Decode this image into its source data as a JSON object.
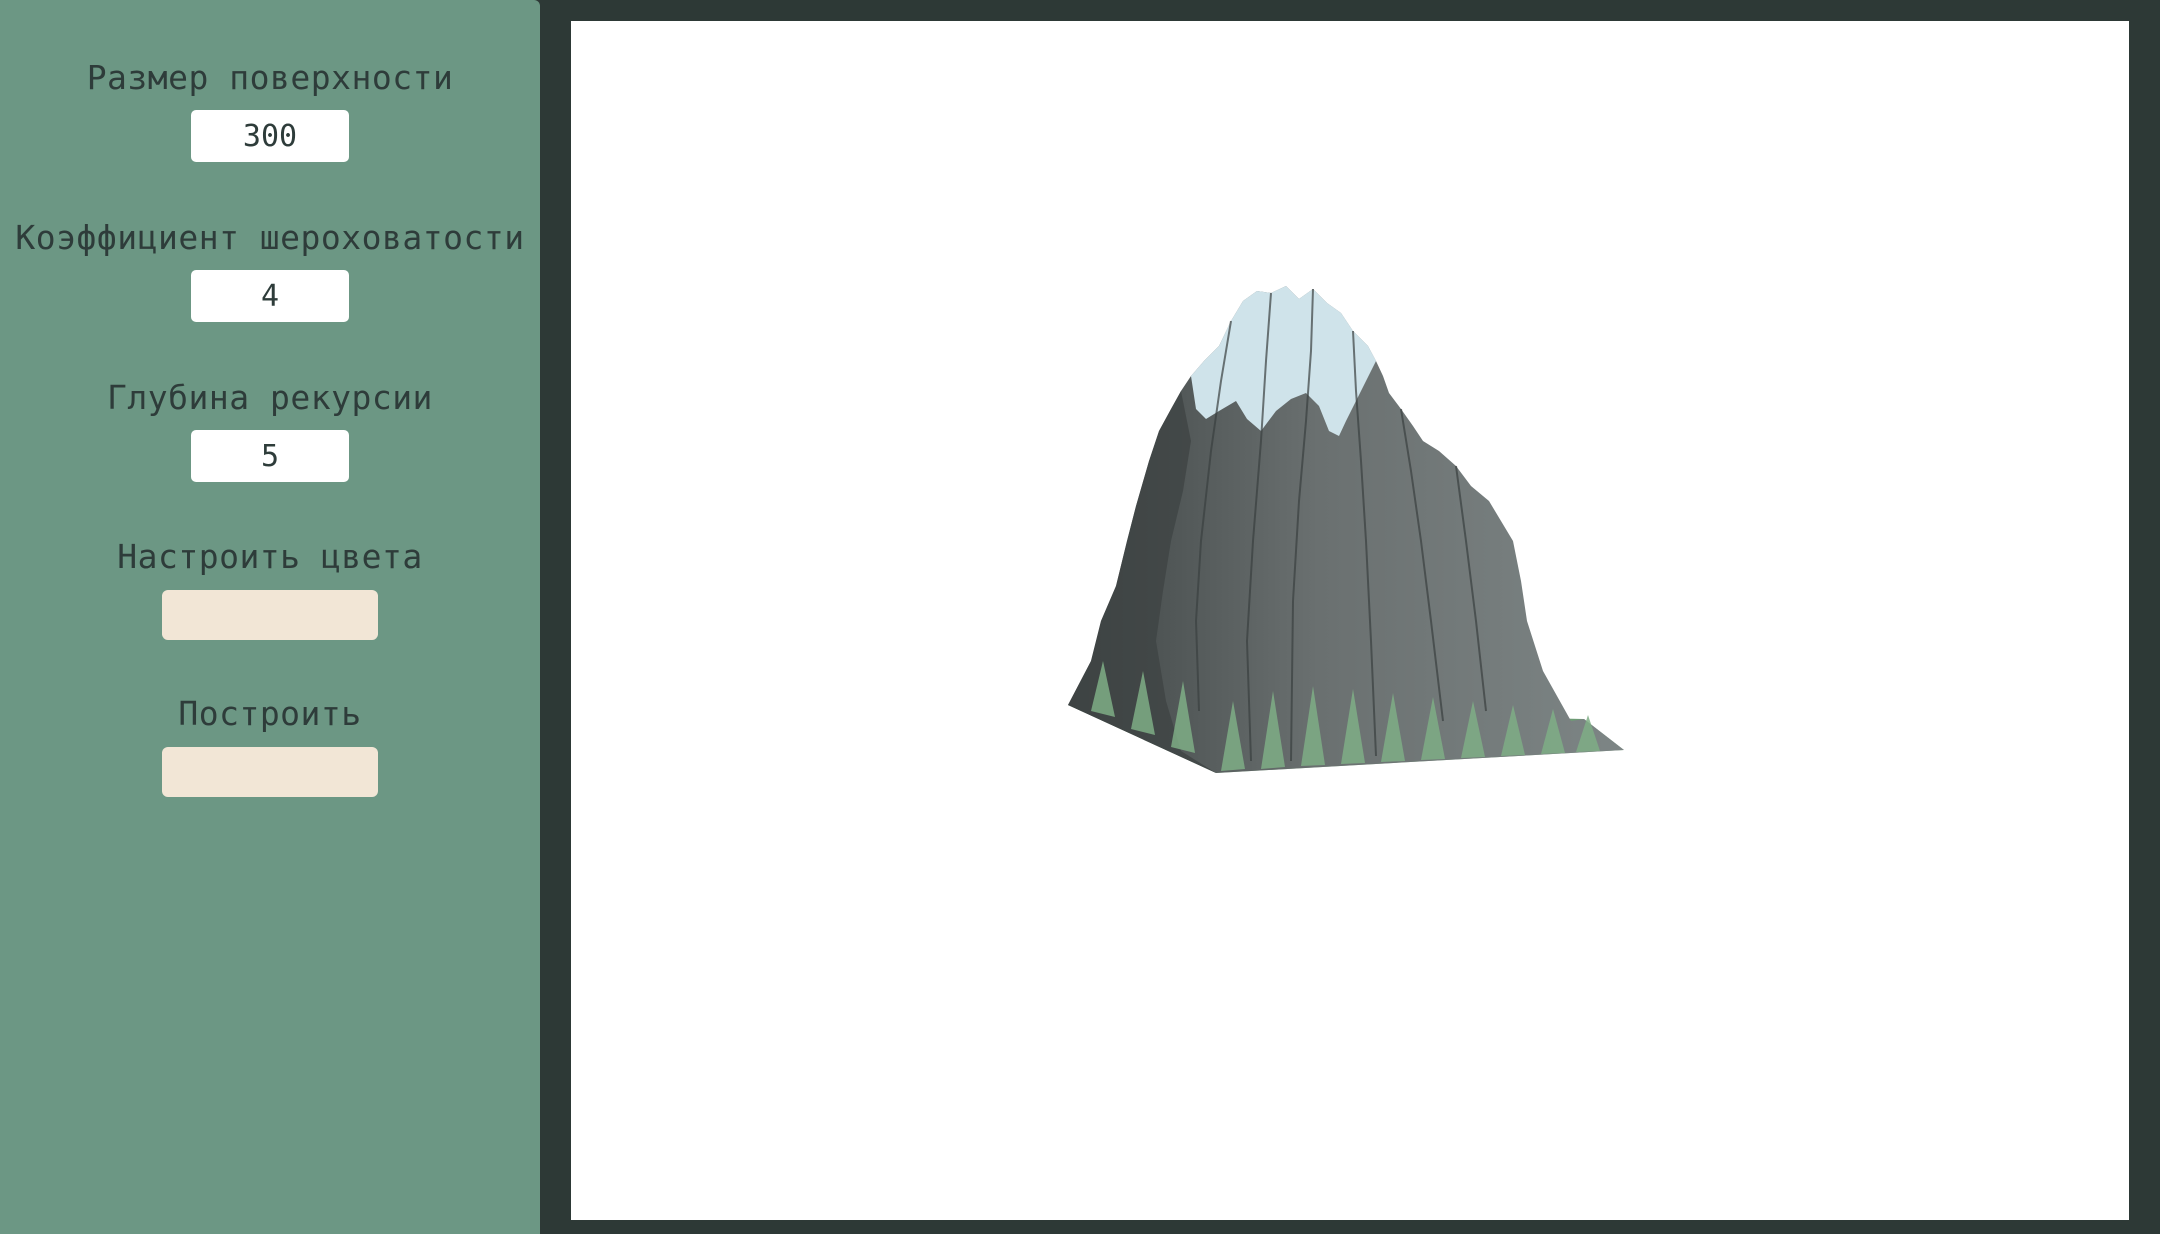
{
  "sidebar": {
    "surface_size": {
      "label": "Размер поверхности",
      "value": "300"
    },
    "roughness": {
      "label": "Коэффициент шероховатости",
      "value": "4"
    },
    "recursion_depth": {
      "label": "Глубина рекурсии",
      "value": "5"
    },
    "colors": {
      "label": "Настроить цвета"
    },
    "build": {
      "label": "Построить"
    }
  },
  "colors": {
    "sidebar_bg": "#6c9784",
    "frame_bg": "#2d3936",
    "button_bg": "#f2e6d6",
    "terrain_snow": "#cfe3ea",
    "terrain_rock": "#6e7575",
    "terrain_grass": "#8fbf95"
  }
}
